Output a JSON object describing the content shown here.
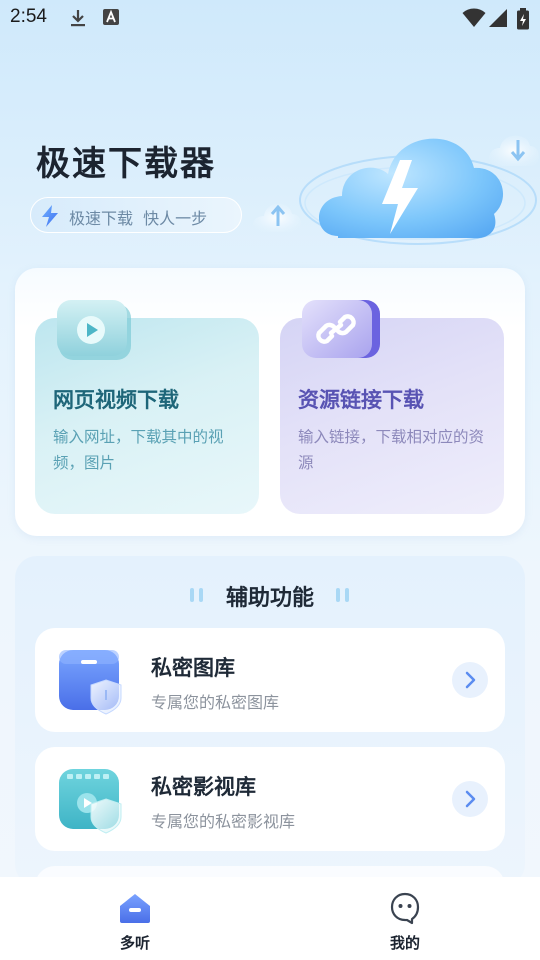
{
  "status_bar": {
    "time": "2:54",
    "icons": [
      "download-icon",
      "a-box-icon",
      "wifi-icon",
      "signal-icon",
      "battery-icon"
    ]
  },
  "hero": {
    "title": "极速下载器",
    "slogan": "极速下载  快人一步",
    "icons": [
      "lightning-icon",
      "cloud-lightning-icon",
      "upload-arrow-icon",
      "download-arrow-icon"
    ]
  },
  "features": [
    {
      "title": "网页视频下载",
      "desc": "输入网址，下载其中的视频，图片",
      "icon": "video-play-icon",
      "color": "#1e6679"
    },
    {
      "title": "资源链接下载",
      "desc": "输入链接，下载相对应的资源",
      "icon": "link-icon",
      "color": "#5853b3"
    }
  ],
  "aux": {
    "title": "辅助功能",
    "items": [
      {
        "title": "私密图库",
        "subtitle": "专属您的私密图库",
        "icon": "private-gallery-icon"
      },
      {
        "title": "私密影视库",
        "subtitle": "专属您的私密影视库",
        "icon": "private-video-icon"
      }
    ]
  },
  "bottom_nav": {
    "items": [
      {
        "label": "多听",
        "icon": "home-icon",
        "active": true
      },
      {
        "label": "我的",
        "icon": "profile-icon",
        "active": false
      }
    ]
  },
  "colors": {
    "accent_blue": "#5b8cf0",
    "teal": "#1e6679",
    "purple": "#5853b3",
    "background": "#e3f2fd"
  }
}
